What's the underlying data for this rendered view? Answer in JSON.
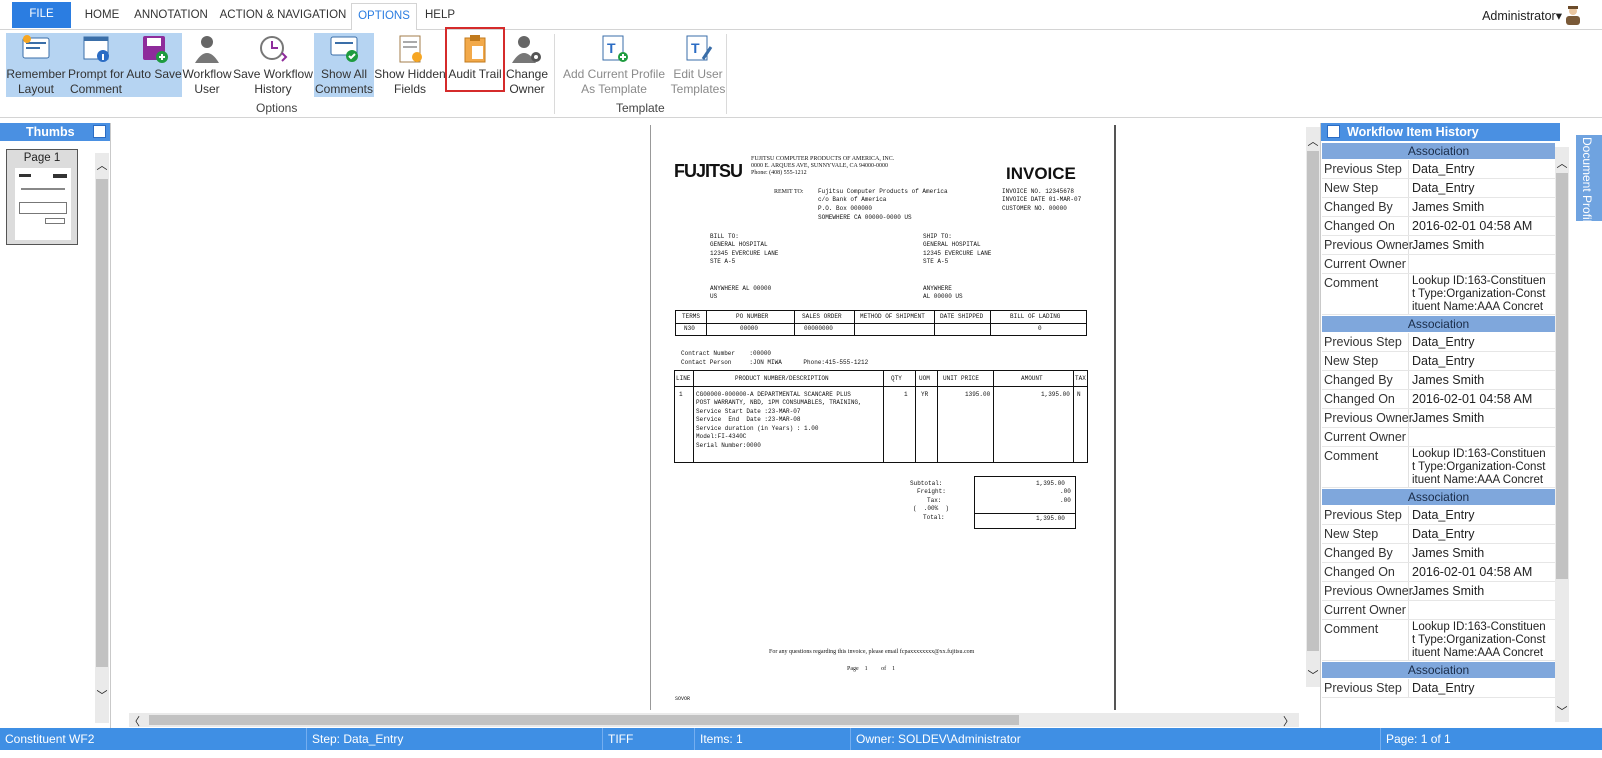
{
  "tabs": {
    "file": "FILE",
    "home": "HOME",
    "annotation": "ANNOTATION",
    "action_navigation": "ACTION & NAVIGATION",
    "options": "OPTIONS",
    "help": "HELP"
  },
  "user": {
    "name": "Administrator▾"
  },
  "ribbon": {
    "remember_layout": [
      "Remember",
      "Layout"
    ],
    "prompt_for_comment": [
      "Prompt for",
      "Comment"
    ],
    "auto_save": [
      "Auto Save",
      ""
    ],
    "workflow_user": [
      "Workflow",
      "User"
    ],
    "save_workflow_history": [
      "Save Workflow",
      "History"
    ],
    "show_all_comments": [
      "Show All",
      "Comments"
    ],
    "show_hidden_fields": [
      "Show Hidden",
      "Fields"
    ],
    "audit_trail": [
      "Audit Trail",
      ""
    ],
    "change_owner": [
      "Change",
      "Owner"
    ],
    "add_current_profile": [
      "Add Current Profile",
      "As Template"
    ],
    "edit_user_templates": [
      "Edit User",
      "Templates"
    ],
    "group_options": "Options",
    "group_template": "Template"
  },
  "thumbs": {
    "title": "Thumbs",
    "page_label": "Page 1"
  },
  "history": {
    "title": "Workflow Item History",
    "assoc_label": "Association",
    "labels": {
      "previous_step": "Previous Step",
      "new_step": "New Step",
      "changed_by": "Changed By",
      "changed_on": "Changed On",
      "previous_owner": "Previous Owner",
      "current_owner": "Current Owner",
      "comment": "Comment"
    },
    "entries": [
      {
        "previous_step": "Data_Entry",
        "new_step": "Data_Entry",
        "changed_by": "James Smith",
        "changed_on": "2016-02-01 04:58 AM",
        "previous_owner": "James Smith",
        "current_owner": "",
        "comment": [
          "Lookup ID:163-Constituen",
          "t Type:Organization-Const",
          "ituent Name:AAA Concret"
        ]
      },
      {
        "previous_step": "Data_Entry",
        "new_step": "Data_Entry",
        "changed_by": "James Smith",
        "changed_on": "2016-02-01 04:58 AM",
        "previous_owner": "James Smith",
        "current_owner": "",
        "comment": [
          "Lookup ID:163-Constituen",
          "t Type:Organization-Const",
          "ituent Name:AAA Concret"
        ]
      },
      {
        "previous_step": "Data_Entry",
        "new_step": "Data_Entry",
        "changed_by": "James Smith",
        "changed_on": "2016-02-01 04:58 AM",
        "previous_owner": "James Smith",
        "current_owner": "",
        "comment": [
          "Lookup ID:163-Constituen",
          "t Type:Organization-Const",
          "ituent Name:AAA Concret"
        ]
      },
      {
        "previous_step": "Data_Entry"
      }
    ]
  },
  "side_tab": {
    "label": "Document Profile"
  },
  "status": {
    "workflow": "Constituent WF2",
    "step": "Step: Data_Entry",
    "format": "TIFF",
    "items": "Items: 1",
    "owner": "Owner: SOLDEV\\Administrator",
    "page": "Page: 1 of 1"
  },
  "invoice": {
    "logo": "FUJITSU",
    "company": [
      "FUJITSU COMPUTER PRODUCTS OF AMERICA, INC.",
      "0000 E. ARQUES AVE, SUNNYVALE, CA 94000-0000",
      "Phone: (408) 555-1212"
    ],
    "title": "INVOICE",
    "remit_label": "REMIT TO:",
    "remit": [
      "Fujitsu Computer Products of America",
      "c/o Bank of America",
      "P.O. Box 000000",
      "SOMEWHERE CA 00000-0000 US"
    ],
    "meta": [
      "INVOICE NO. 12345678",
      "INVOICE DATE 01-MAR-07",
      "CUSTOMER NO. 00000"
    ],
    "bill_to": [
      "BILL TO:",
      "GENERAL HOSPITAL",
      "12345 EVERCURE LANE",
      "STE A-5",
      "",
      "",
      "ANYWHERE AL 00000",
      "US"
    ],
    "ship_to": [
      "SHIP TO:",
      "GENERAL HOSPITAL",
      "12345 EVERCURE LANE",
      "STE A-5",
      "",
      "",
      "ANYWHERE",
      "AL 00000 US"
    ],
    "terms_headers": [
      "TERMS",
      "PO NUMBER",
      "SALES ORDER",
      "METHOD OF SHIPMENT",
      "DATE SHIPPED",
      "BILL OF LADING"
    ],
    "terms_values": [
      "N30",
      "00000",
      "00000000",
      "",
      "",
      "0"
    ],
    "contact": [
      "Contract Number    :00000",
      "Contact Person     :JON MIWA      Phone:415-555-1212"
    ],
    "line_headers": [
      "LINE",
      "PRODUCT NUMBER/DESCRIPTION",
      "QTY",
      "UOM",
      "UNIT PRICE",
      "AMOUNT",
      "TAX"
    ],
    "line_no": "1",
    "line_desc": [
      "CG00000-000000-A DEPARTMENTAL SCANCARE PLUS",
      "POST WARRANTY, NBD, 1PM CONSUMABLES, TRAINING,",
      "Service Start Date :23-MAR-07",
      "Service  End  Date :23-MAR-08",
      "Service duration (in Years) : 1.00",
      "Model:FI-4340C",
      "Serial Number:0000"
    ],
    "line_qty": "1",
    "line_uom": "YR",
    "line_price": "1395.00",
    "line_amount": "1,395.00",
    "line_tax": "N",
    "totals_labels": [
      "Subtotal:",
      "Freight:",
      "Tax:",
      "(  .00%  )",
      "Total:"
    ],
    "totals_values": [
      "1,395.00",
      ".00",
      ".00",
      "",
      "1,395.00"
    ],
    "footer": "For any questions regarding this invoice, please email fcpaxxxxxxxx@xx.fujitsu.com",
    "page_footer": "Page    1         of    1",
    "corner": "SOVOR"
  }
}
